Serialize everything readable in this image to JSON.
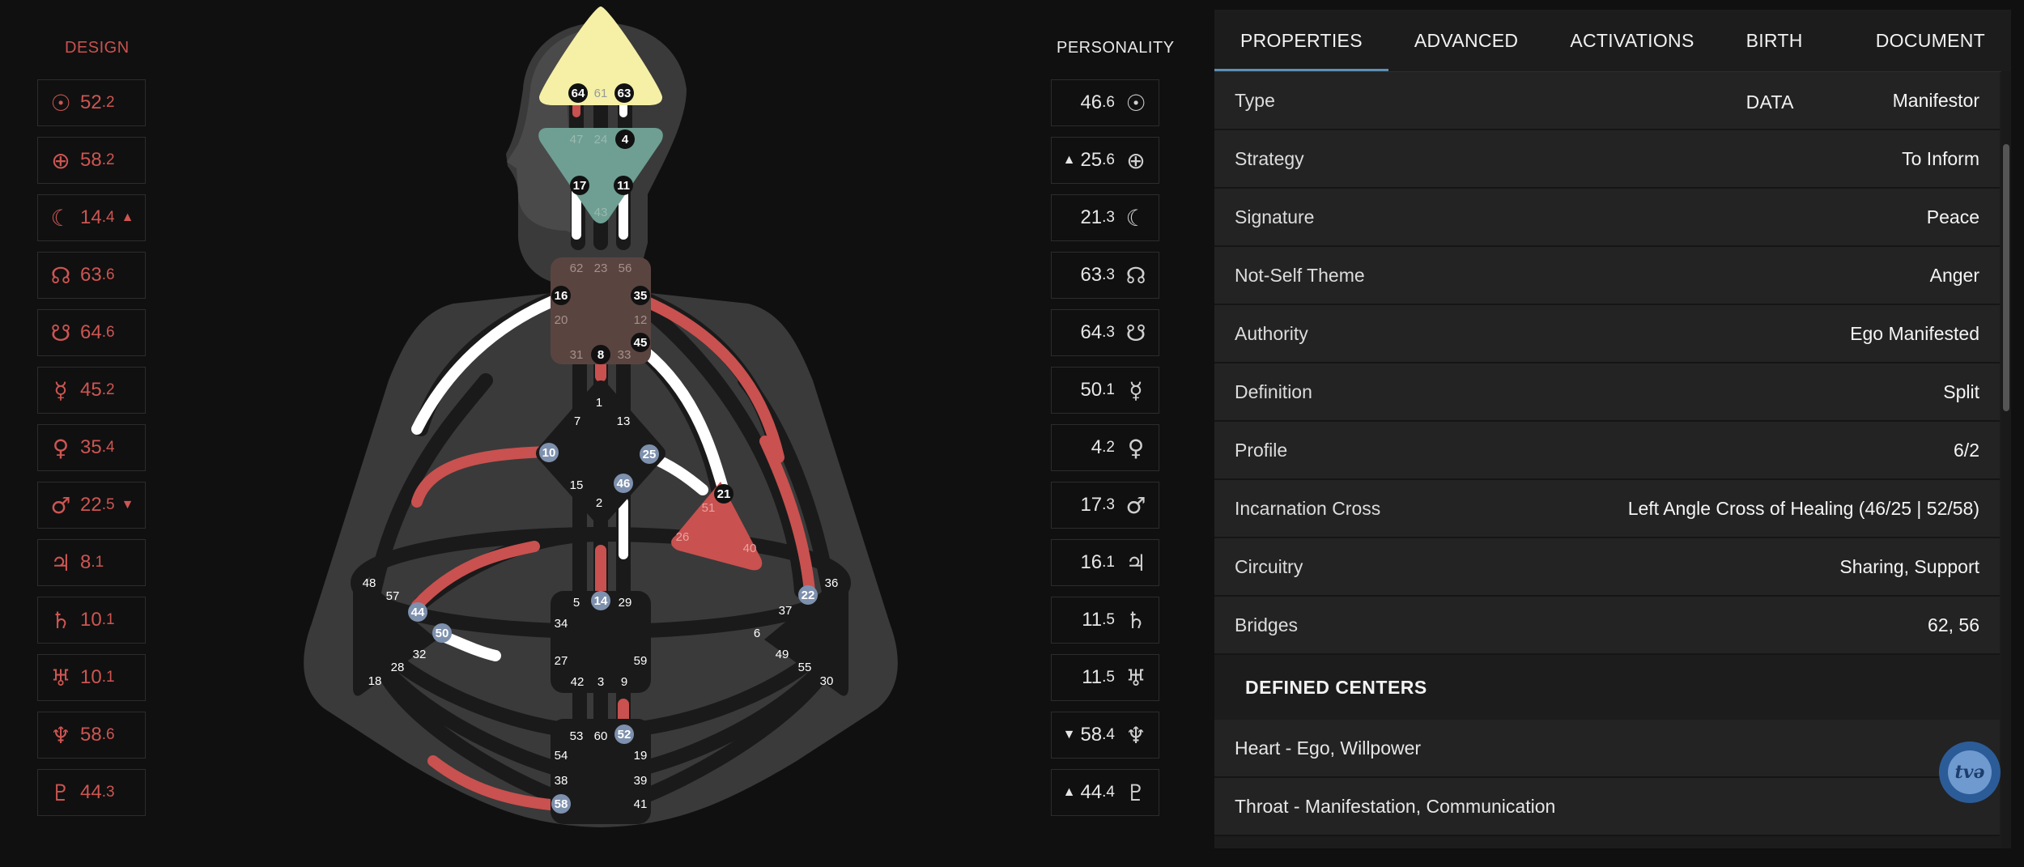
{
  "design": {
    "label": "DESIGN",
    "activations": [
      {
        "planet": "sun-icon",
        "glyph": "☉",
        "gate": "52",
        "line": "2",
        "arrow": ""
      },
      {
        "planet": "earth-icon",
        "glyph": "⊕",
        "gate": "58",
        "line": "2",
        "arrow": ""
      },
      {
        "planet": "moon-icon",
        "glyph": "☾",
        "gate": "14",
        "line": "4",
        "arrow": "▲"
      },
      {
        "planet": "north-node-icon",
        "glyph": "☊",
        "gate": "63",
        "line": "6",
        "arrow": ""
      },
      {
        "planet": "south-node-icon",
        "glyph": "☋",
        "gate": "64",
        "line": "6",
        "arrow": ""
      },
      {
        "planet": "mercury-icon",
        "glyph": "☿",
        "gate": "45",
        "line": "2",
        "arrow": ""
      },
      {
        "planet": "venus-icon",
        "glyph": "♀",
        "gate": "35",
        "line": "4",
        "arrow": ""
      },
      {
        "planet": "mars-icon",
        "glyph": "♂",
        "gate": "22",
        "line": "5",
        "arrow": "▼"
      },
      {
        "planet": "jupiter-icon",
        "glyph": "♃",
        "gate": "8",
        "line": "1",
        "arrow": ""
      },
      {
        "planet": "saturn-icon",
        "glyph": "♄",
        "gate": "10",
        "line": "1",
        "arrow": ""
      },
      {
        "planet": "uranus-icon",
        "glyph": "♅",
        "gate": "10",
        "line": "1",
        "arrow": ""
      },
      {
        "planet": "neptune-icon",
        "glyph": "♆",
        "gate": "58",
        "line": "6",
        "arrow": ""
      },
      {
        "planet": "pluto-icon",
        "glyph": "♇",
        "gate": "44",
        "line": "3",
        "arrow": ""
      }
    ]
  },
  "personality": {
    "label": "PERSONALITY",
    "activations": [
      {
        "planet": "sun-icon",
        "glyph": "☉",
        "gate": "46",
        "line": "6",
        "arrow": ""
      },
      {
        "planet": "earth-icon",
        "glyph": "⊕",
        "gate": "25",
        "line": "6",
        "arrow": "▲"
      },
      {
        "planet": "moon-icon",
        "glyph": "☾",
        "gate": "21",
        "line": "3",
        "arrow": ""
      },
      {
        "planet": "north-node-icon",
        "glyph": "☊",
        "gate": "63",
        "line": "3",
        "arrow": ""
      },
      {
        "planet": "south-node-icon",
        "glyph": "☋",
        "gate": "64",
        "line": "3",
        "arrow": ""
      },
      {
        "planet": "mercury-icon",
        "glyph": "☿",
        "gate": "50",
        "line": "1",
        "arrow": ""
      },
      {
        "planet": "venus-icon",
        "glyph": "♀",
        "gate": "4",
        "line": "2",
        "arrow": ""
      },
      {
        "planet": "mars-icon",
        "glyph": "♂",
        "gate": "17",
        "line": "3",
        "arrow": ""
      },
      {
        "planet": "jupiter-icon",
        "glyph": "♃",
        "gate": "16",
        "line": "1",
        "arrow": ""
      },
      {
        "planet": "saturn-icon",
        "glyph": "♄",
        "gate": "11",
        "line": "5",
        "arrow": ""
      },
      {
        "planet": "uranus-icon",
        "glyph": "♅",
        "gate": "11",
        "line": "5",
        "arrow": ""
      },
      {
        "planet": "neptune-icon",
        "glyph": "♆",
        "gate": "58",
        "line": "4",
        "arrow": "▼"
      },
      {
        "planet": "pluto-icon",
        "glyph": "♇",
        "gate": "44",
        "line": "4",
        "arrow": "▲"
      }
    ]
  },
  "colors": {
    "design_red": "#c9514f",
    "head_yellow": "#f5f0a6",
    "ajna_green": "#6e9f92",
    "throat_brown": "#5a4440",
    "heart_red": "#c9514f",
    "accent_blue": "#5d8fb3",
    "gate_blue": "#7a8fae"
  },
  "bodygraph": {
    "gates": {
      "g64": "64",
      "g61": "61",
      "g63": "63",
      "g47": "47",
      "g24": "24",
      "g4": "4",
      "g17": "17",
      "g11": "11",
      "g43": "43",
      "g62": "62",
      "g23": "23",
      "g56": "56",
      "g16": "16",
      "g35": "35",
      "g20": "20",
      "g12": "12",
      "g31": "31",
      "g8": "8",
      "g33": "33",
      "g45": "45",
      "g1": "1",
      "g7": "7",
      "g13": "13",
      "g10": "10",
      "g25": "25",
      "g15": "15",
      "g46": "46",
      "g2": "2",
      "g21": "21",
      "g51": "51",
      "g26": "26",
      "g40": "40",
      "g48": "48",
      "g57": "57",
      "g44": "44",
      "g50": "50",
      "g32": "32",
      "g28": "28",
      "g18": "18",
      "g5": "5",
      "g14": "14",
      "g29": "29",
      "g34": "34",
      "g27": "27",
      "g59": "59",
      "g42": "42",
      "g3": "3",
      "g9": "9",
      "g36": "36",
      "g22": "22",
      "g37": "37",
      "g6": "6",
      "g49": "49",
      "g55": "55",
      "g30": "30",
      "g53": "53",
      "g60": "60",
      "g52": "52",
      "g54": "54",
      "g19": "19",
      "g38": "38",
      "g39": "39",
      "g58": "58",
      "g41": "41"
    }
  },
  "panel": {
    "tabs": [
      "PROPERTIES",
      "ADVANCED",
      "ACTIVATIONS",
      "BIRTH DATA",
      "DOCUMENT"
    ],
    "properties": [
      {
        "key": "Type",
        "value": "Manifestor"
      },
      {
        "key": "Strategy",
        "value": "To Inform"
      },
      {
        "key": "Signature",
        "value": "Peace"
      },
      {
        "key": "Not-Self Theme",
        "value": "Anger"
      },
      {
        "key": "Authority",
        "value": "Ego Manifested"
      },
      {
        "key": "Definition",
        "value": "Split"
      },
      {
        "key": "Profile",
        "value": "6/2"
      },
      {
        "key": "Incarnation Cross",
        "value": "Left Angle Cross of Healing (46/25 | 52/58)"
      },
      {
        "key": "Circuitry",
        "value": "Sharing, Support"
      },
      {
        "key": "Bridges",
        "value": "62, 56"
      }
    ],
    "defined_centers_title": "DEFINED CENTERS",
    "defined_centers": [
      "Heart - Ego, Willpower",
      "Throat - Manifestation, Communication"
    ]
  },
  "fab": {
    "label": "tvǝ"
  }
}
